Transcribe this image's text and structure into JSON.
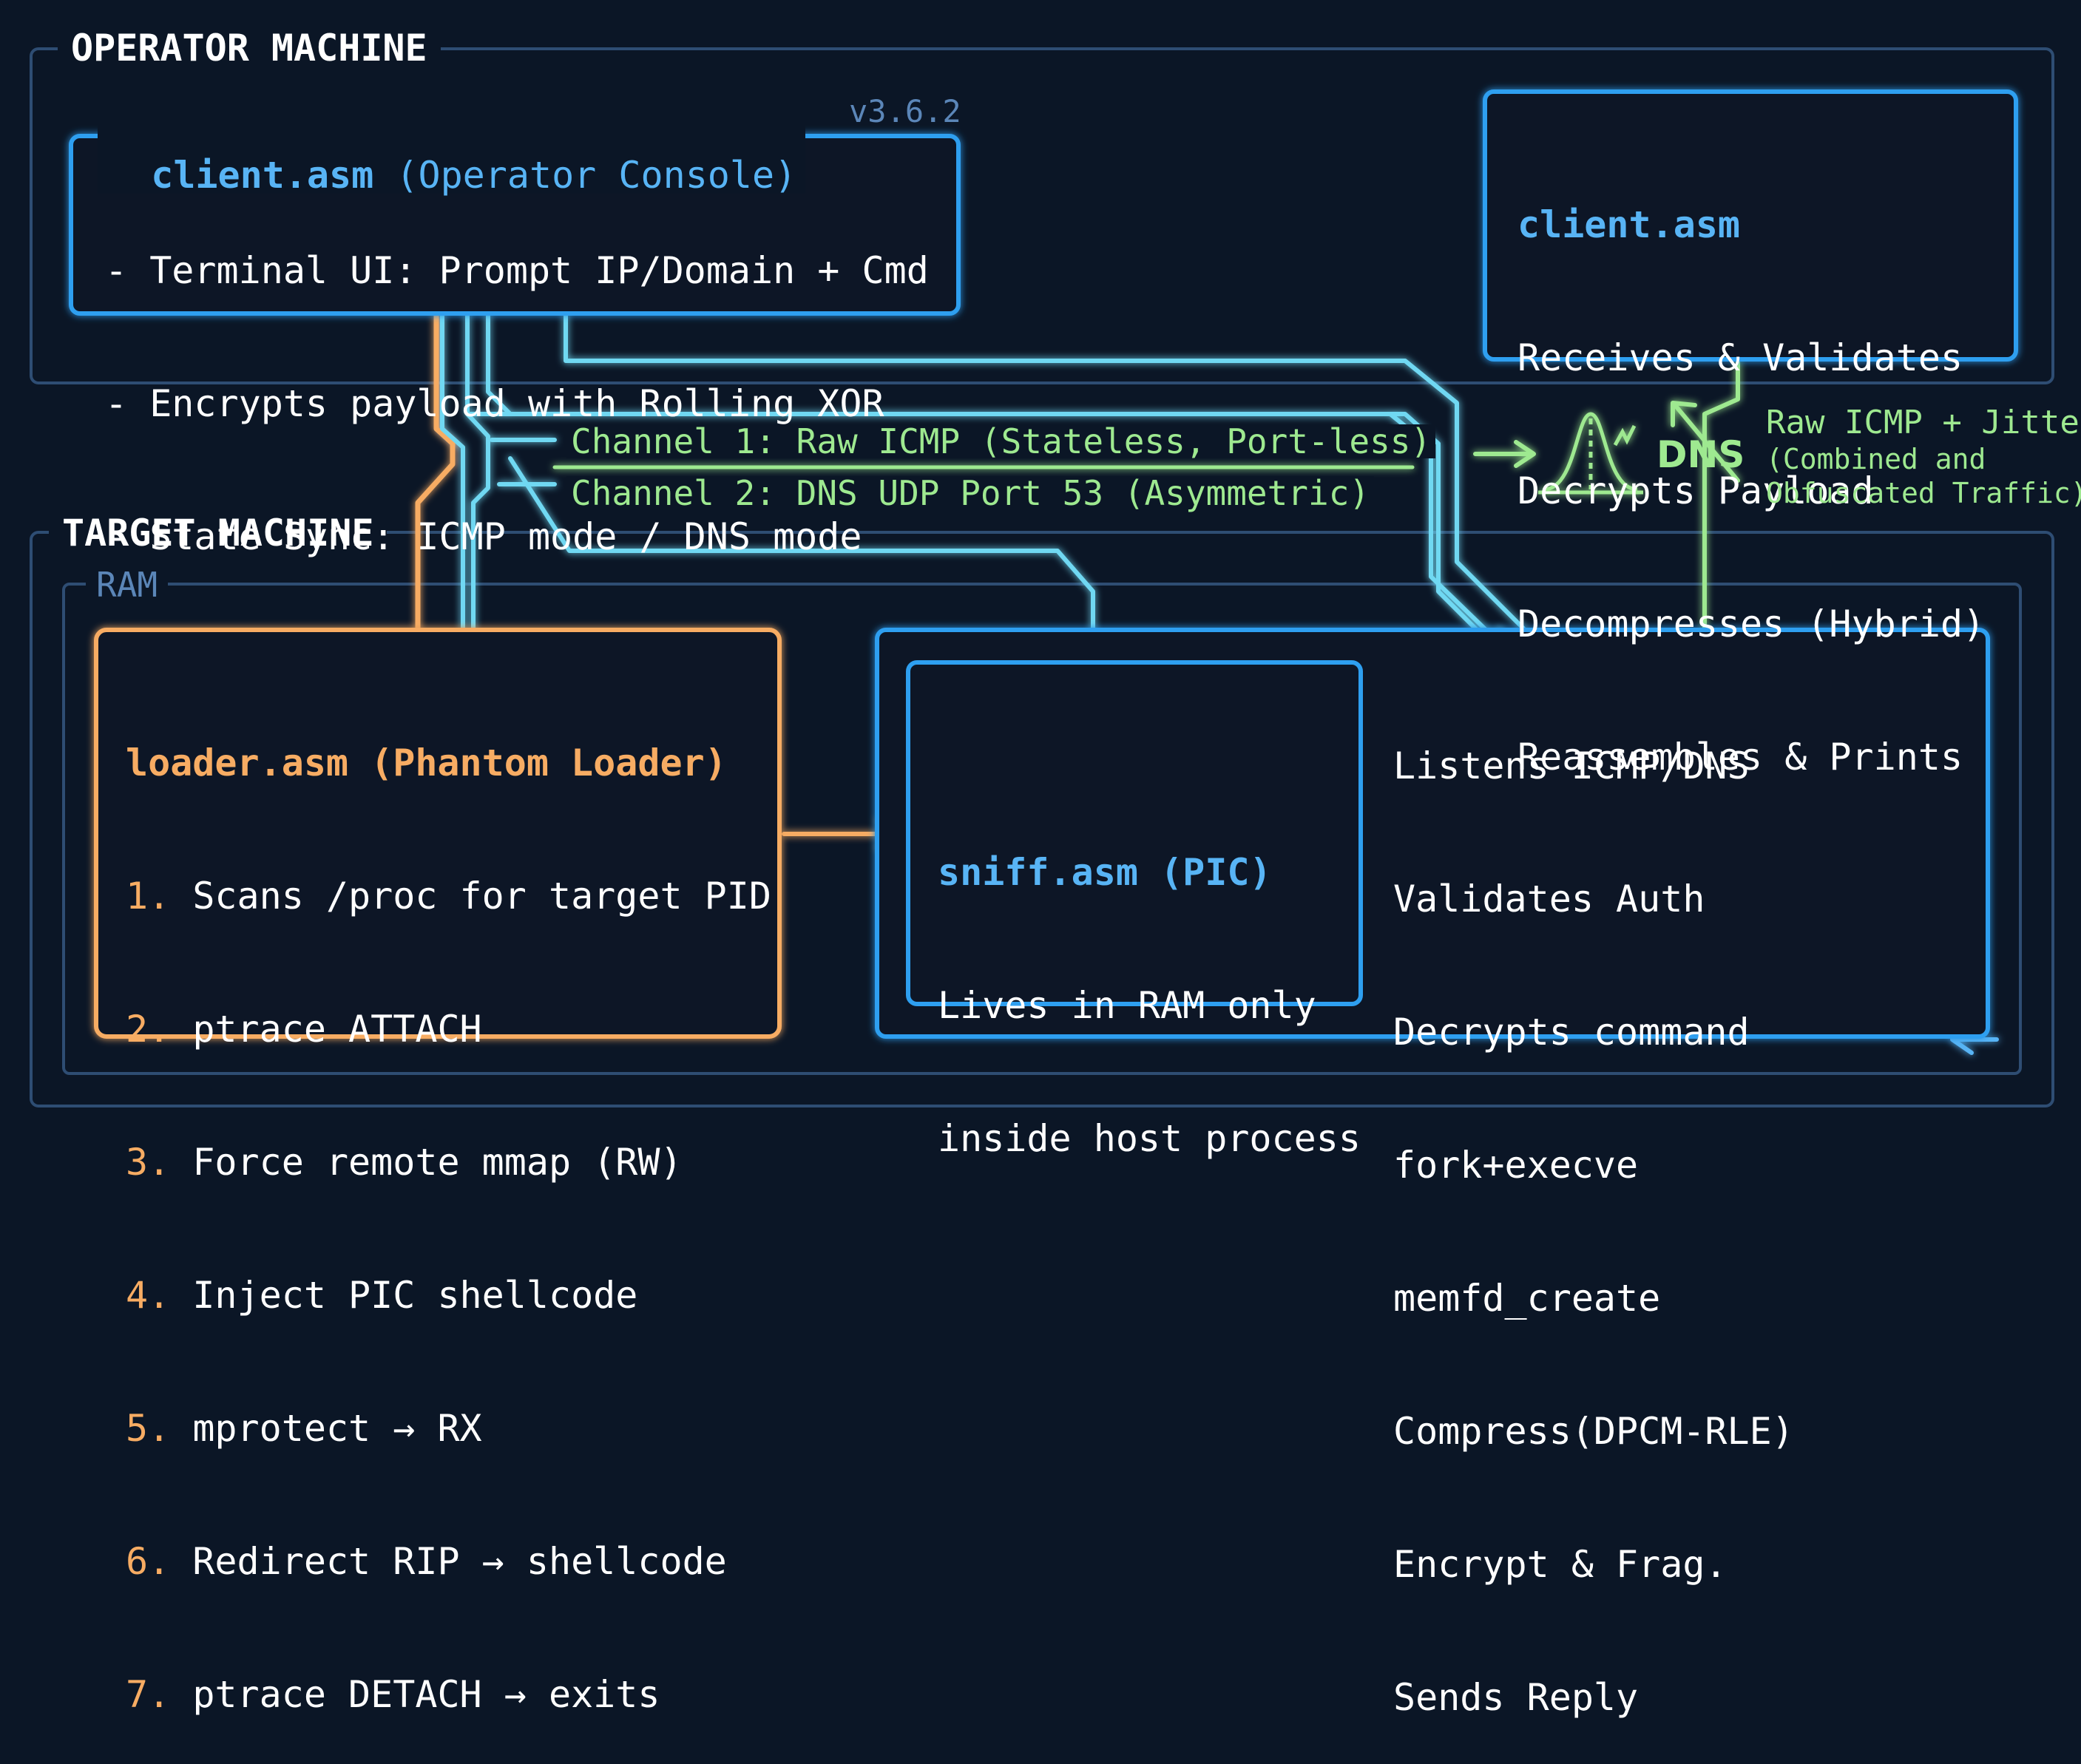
{
  "frames": {
    "operator_title": "OPERATOR MACHINE",
    "target_title": "TARGET MACHINE",
    "ram_title": "RAM"
  },
  "version": "v3.6.2",
  "client_console": {
    "name": "client.asm",
    "subtitle": "(Operator Console)",
    "lines": [
      "- Terminal UI: Prompt IP/Domain + Cmd",
      "- Encrypts payload with Rolling XOR",
      "- State Sync: ICMP mode / DNS mode"
    ]
  },
  "client_receiver": {
    "name": "client.asm",
    "lines": [
      "Receives & Validates",
      "Decrypts Payload",
      "Decompresses (Hybrid)",
      "Reassembles & Prints"
    ]
  },
  "channels": {
    "channel1": "Channel 1: Raw ICMP (Stateless, Port-less)",
    "channel2": "Channel 2: DNS UDP Port 53 (Asymmetric)"
  },
  "traffic": {
    "dns_label": "DNS",
    "line1": "Raw ICMP + Jitter",
    "line2": "(Combined and",
    "line3": "Obfuscated Traffic)"
  },
  "loader": {
    "title": "loader.asm (Phantom Loader)",
    "steps": [
      {
        "num": "1.",
        "text": "Scans /proc for target PID"
      },
      {
        "num": "2.",
        "text": "ptrace ATTACH"
      },
      {
        "num": "3.",
        "text": "Force remote mmap (RW)"
      },
      {
        "num": "4.",
        "text": "Inject PIC shellcode"
      },
      {
        "num": "5.",
        "text": "mprotect → RX"
      },
      {
        "num": "6.",
        "text": "Redirect RIP → shellcode"
      },
      {
        "num": "7.",
        "text": "ptrace DETACH → exits"
      }
    ]
  },
  "sniff": {
    "title": "sniff.asm (PIC)",
    "lines": [
      "Lives in RAM only",
      "inside host process"
    ]
  },
  "sniff_actions": [
    "Listens ICMP/DNS",
    "Validates Auth",
    "Decrypts command",
    "fork+execve",
    "memfd_create",
    "Compress(DPCM-RLE)",
    "Encrypt & Frag.",
    "Sends Reply"
  ],
  "colors": {
    "background": "#0b1626",
    "frame_border": "#2e4d73",
    "cyan_box": "#2f9ff0",
    "cyan_wire": "#6fd8f2",
    "orange": "#f7ac63",
    "green": "#9ee990",
    "text": "#ffffff"
  }
}
